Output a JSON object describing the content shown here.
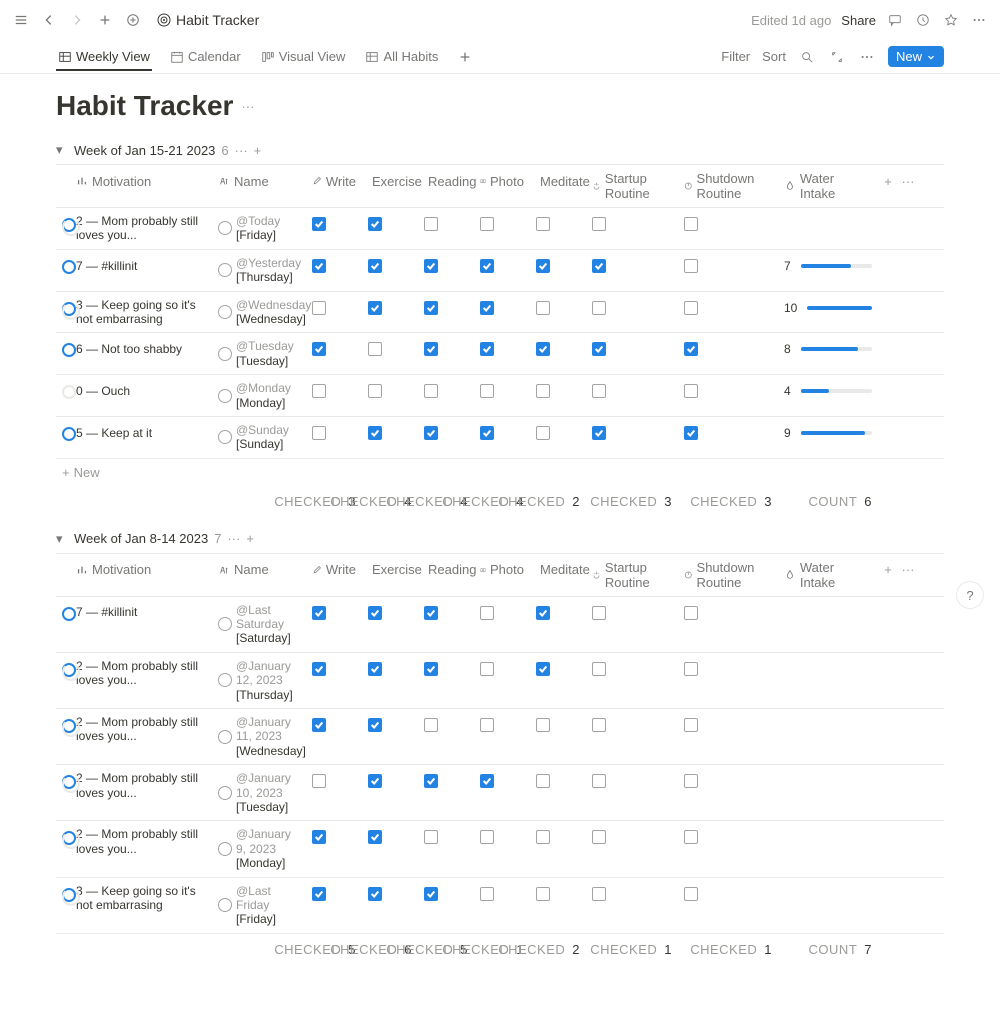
{
  "topbar": {
    "breadcrumb_icon": "target",
    "breadcrumb": "Habit Tracker",
    "edited": "Edited 1d ago",
    "share": "Share"
  },
  "views": {
    "tabs": [
      {
        "icon": "table",
        "label": "Weekly View",
        "active": true
      },
      {
        "icon": "calendar",
        "label": "Calendar"
      },
      {
        "icon": "board",
        "label": "Visual View"
      },
      {
        "icon": "table",
        "label": "All Habits"
      }
    ],
    "filter": "Filter",
    "sort": "Sort",
    "new": "New"
  },
  "page": {
    "title": "Habit Tracker"
  },
  "columns": {
    "motivation": "Motivation",
    "name": "Name",
    "write": "Write",
    "exercise": "Exercise",
    "reading": "Reading",
    "photo": "Photo",
    "meditate": "Meditate",
    "startup": "Startup Routine",
    "shutdown": "Shutdown Routine",
    "water": "Water Intake"
  },
  "groups": [
    {
      "title": "Week of Jan 15-21 2023",
      "count": "6",
      "rows": [
        {
          "motiv": "2 — Mom probably still loves you...",
          "motiv_level": "low",
          "name_at": "@Today",
          "name_day": "[Friday]",
          "write": true,
          "exercise": true,
          "reading": false,
          "photo": false,
          "meditate": false,
          "startup": false,
          "shutdown": false,
          "water": null
        },
        {
          "motiv": "7 — #killinit",
          "motiv_level": "mid",
          "name_at": "@Yesterday",
          "name_day": "[Thursday]",
          "write": true,
          "exercise": true,
          "reading": true,
          "photo": true,
          "meditate": true,
          "startup": true,
          "shutdown": false,
          "water": 7
        },
        {
          "motiv": "3 — Keep going so it's not embarrasing",
          "motiv_level": "low",
          "name_at": "@Wednesday",
          "name_day": "[Wednesday]",
          "write": false,
          "exercise": true,
          "reading": true,
          "photo": true,
          "meditate": false,
          "startup": false,
          "shutdown": false,
          "water": 10
        },
        {
          "motiv": "6 — Not too shabby",
          "motiv_level": "mid",
          "name_at": "@Tuesday",
          "name_day": "[Tuesday]",
          "write": true,
          "exercise": false,
          "reading": true,
          "photo": true,
          "meditate": true,
          "startup": true,
          "shutdown": true,
          "water": 8
        },
        {
          "motiv": "0 — Ouch",
          "motiv_level": "empty",
          "name_at": "@Monday",
          "name_day": "[Monday]",
          "write": false,
          "exercise": false,
          "reading": false,
          "photo": false,
          "meditate": false,
          "startup": false,
          "shutdown": false,
          "water": 4
        },
        {
          "motiv": "5 — Keep at it",
          "motiv_level": "mid",
          "name_at": "@Sunday",
          "name_day": "[Sunday]",
          "write": false,
          "exercise": true,
          "reading": true,
          "photo": true,
          "meditate": false,
          "startup": true,
          "shutdown": true,
          "water": 9
        }
      ],
      "newrow": "New",
      "summary": {
        "write": "3",
        "exercise": "4",
        "reading": "4",
        "photo": "4",
        "meditate": "2",
        "startup": "3",
        "shutdown": "3",
        "water": "6",
        "label": "CHECKED",
        "count_label": "COUNT"
      }
    },
    {
      "title": "Week of Jan 8-14 2023",
      "count": "7",
      "rows": [
        {
          "motiv": "7 — #killinit",
          "motiv_level": "mid",
          "name_at": "@Last Saturday",
          "name_day": "[Saturday]",
          "write": true,
          "exercise": true,
          "reading": true,
          "photo": false,
          "meditate": true,
          "startup": false,
          "shutdown": false,
          "water": null
        },
        {
          "motiv": "2 — Mom probably still loves you...",
          "motiv_level": "low",
          "name_at": "@January 12, 2023",
          "name_day": "[Thursday]",
          "write": true,
          "exercise": true,
          "reading": true,
          "photo": false,
          "meditate": true,
          "startup": false,
          "shutdown": false,
          "water": null
        },
        {
          "motiv": "2 — Mom probably still loves you...",
          "motiv_level": "low",
          "name_at": "@January 11, 2023",
          "name_day": "[Wednesday]",
          "write": true,
          "exercise": true,
          "reading": false,
          "photo": false,
          "meditate": false,
          "startup": false,
          "shutdown": false,
          "water": null
        },
        {
          "motiv": "2 — Mom probably still loves you...",
          "motiv_level": "low",
          "name_at": "@January 10, 2023",
          "name_day": "[Tuesday]",
          "write": false,
          "exercise": true,
          "reading": true,
          "photo": true,
          "meditate": false,
          "startup": false,
          "shutdown": false,
          "water": null
        },
        {
          "motiv": "2 — Mom probably still loves you...",
          "motiv_level": "low",
          "name_at": "@January 9, 2023",
          "name_day": "[Monday]",
          "write": true,
          "exercise": true,
          "reading": false,
          "photo": false,
          "meditate": false,
          "startup": false,
          "shutdown": false,
          "water": null
        },
        {
          "motiv": "3 — Keep going so it's not embarrasing",
          "motiv_level": "low",
          "name_at": "@Last Friday",
          "name_day": "[Friday]",
          "write": true,
          "exercise": true,
          "reading": true,
          "photo": false,
          "meditate": false,
          "startup": false,
          "shutdown": false,
          "water": null
        }
      ],
      "summary": {
        "write": "5",
        "exercise": "6",
        "reading": "5",
        "photo": "1",
        "meditate": "2",
        "startup": "1",
        "shutdown": "1",
        "water": "7",
        "label": "CHECKED",
        "count_label": "COUNT"
      }
    }
  ]
}
